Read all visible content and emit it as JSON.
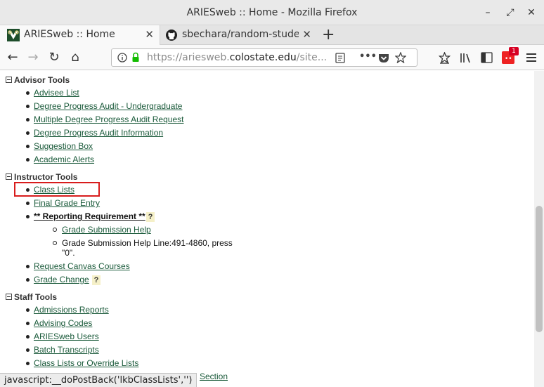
{
  "window": {
    "title": "ARIESweb :: Home - Mozilla Firefox"
  },
  "tabs": [
    {
      "label": "ARIESweb :: Home",
      "icon": "ram-logo-icon",
      "active": true
    },
    {
      "label": "sbechara/random-studen",
      "icon": "github-icon",
      "active": false
    }
  ],
  "nav": {
    "url_prefix": "https://ariesweb.",
    "url_domain": "colostate.edu",
    "url_suffix": "/site...",
    "more_label": "•••",
    "notification_count": "1"
  },
  "advisor_tools": {
    "heading": "Advisor Tools",
    "items": [
      "Advisee List",
      "Degree Progress Audit - Undergraduate",
      "Multiple Degree Progress Audit Request",
      "Degree Progress Audit Information",
      "Suggestion Box",
      "Academic Alerts"
    ]
  },
  "instructor_tools": {
    "heading": "Instructor Tools",
    "class_lists": "Class Lists",
    "final_grade_entry": "Final Grade Entry",
    "reporting_requirement": "** Reporting Requirement **",
    "grade_submission_help": "Grade Submission Help",
    "help_line_1": "Grade Submission Help Line:491-4860, press",
    "help_line_2": "\"0\".",
    "request_canvas": "Request Canvas Courses",
    "grade_change": "Grade Change",
    "help_mark": "?"
  },
  "staff_tools": {
    "heading": "Staff Tools",
    "items": [
      "Admissions Reports",
      "Advising Codes",
      "ARIESweb Users",
      "Batch Transcripts",
      "Class Lists or Override Lists"
    ],
    "partial_item": "Section"
  },
  "status": {
    "text": "javascript:__doPostBack('lkbClassLists','')"
  },
  "colors": {
    "link": "#1a5a3a",
    "highlight_border": "#d81c1c",
    "badge": "#d70022"
  }
}
